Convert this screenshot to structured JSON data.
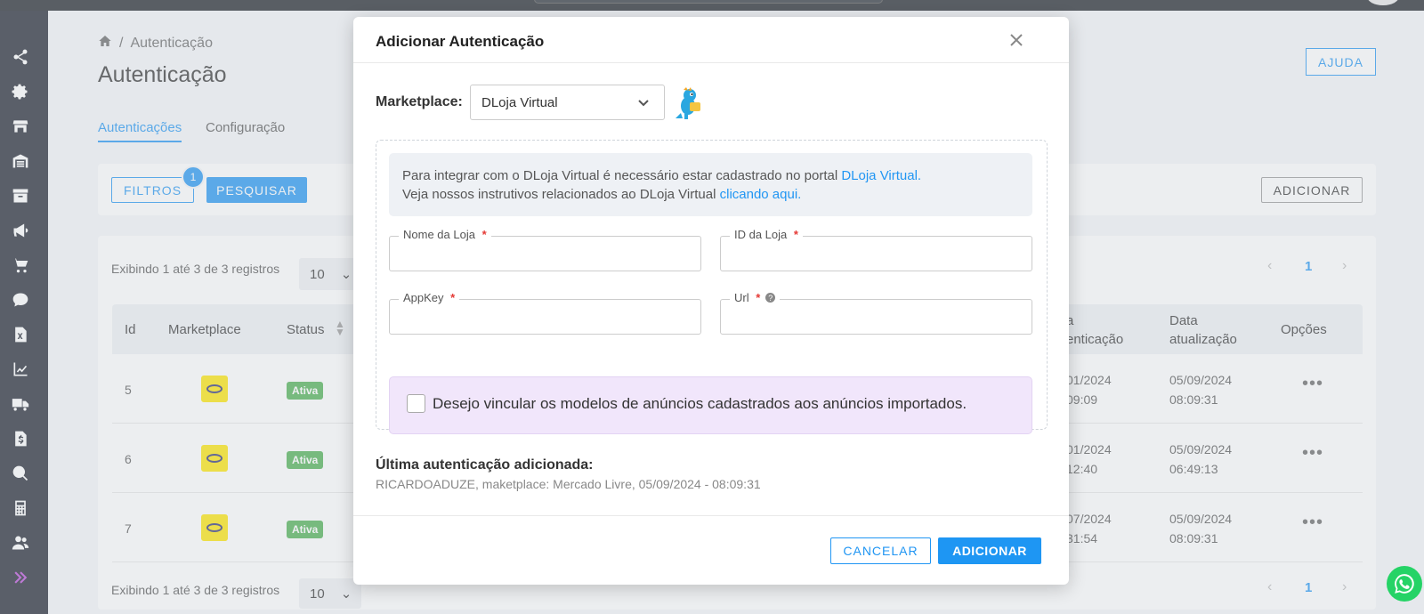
{
  "page": {
    "breadcrumb": "Autenticação",
    "breadcrumb_sep": "/",
    "title": "Autenticação",
    "tabs": [
      {
        "label": "Autenticações"
      },
      {
        "label": "Configuração"
      }
    ],
    "help_label": "AJUDA",
    "filters_label": "FILTROS",
    "filters_badge": "1",
    "search_label": "PESQUISAR",
    "add_label": "ADICIONAR",
    "showing_text": "Exibindo 1 até 3 de 3 registros",
    "per_page": "10",
    "current_page": "1",
    "columns": {
      "id": "Id",
      "marketplace": "Marketplace",
      "status": "Status",
      "auth_date_1": "a",
      "auth_date_2": "enticação",
      "updated_1": "Data",
      "updated_2": "atualização",
      "options": "Opções"
    },
    "rows": [
      {
        "id": "5",
        "status": "Ativa",
        "auth_1": "01/2024",
        "auth_2": "09:09",
        "upd_1": "05/09/2024",
        "upd_2": "08:09:31"
      },
      {
        "id": "6",
        "status": "Ativa",
        "auth_1": "01/2024",
        "auth_2": "12:40",
        "upd_1": "05/09/2024",
        "upd_2": "06:49:13"
      },
      {
        "id": "7",
        "status": "Ativa",
        "auth_1": "07/2024",
        "auth_2": "31:54",
        "upd_1": "05/09/2024",
        "upd_2": "08:09:31"
      }
    ],
    "ml_logo_text": "mercado livre"
  },
  "modal": {
    "title": "Adicionar Autenticação",
    "marketplace_label": "Marketplace:",
    "marketplace_value": "DLoja Virtual",
    "info_line1_prefix": "Para integrar com o DLoja Virtual é necessário estar cadastrado no portal ",
    "info_line1_link": "DLoja Virtual.",
    "info_line2_prefix": "Veja nossos instrutivos relacionados ao DLoja Virtual ",
    "info_line2_link": "clicando aqui.",
    "fields": {
      "store_name": {
        "label": "Nome da Loja",
        "value": ""
      },
      "store_id": {
        "label": "ID da Loja",
        "value": ""
      },
      "appkey": {
        "label": "AppKey",
        "value": ""
      },
      "url": {
        "label": "Url",
        "value": ""
      }
    },
    "required_mark": "*",
    "help_mark": "?",
    "checkbox_label": "Desejo vincular os modelos de anúncios cadastrados aos anúncios importados.",
    "checkbox_checked": false,
    "last_title": "Última autenticação adicionada:",
    "last_text": "RICARDOADUZE, maketplace: Mercado Livre, 05/09/2024 - 08:09:31",
    "cancel_label": "CANCELAR",
    "add_label": "ADICIONAR"
  },
  "colors": {
    "accent": "#2196f3",
    "success": "#4caf50",
    "sidebar": "#1f2430",
    "checkbox_bg": "#f1e6fb"
  },
  "icons": {
    "sidebar": [
      "share-icon",
      "gear-icon",
      "store-icon",
      "warehouse-icon",
      "archive-icon",
      "megaphone-icon",
      "cart-icon",
      "chat-icon",
      "excel-file-icon",
      "chart-line-icon",
      "truck-icon",
      "invoice-icon",
      "search-money-icon",
      "calculator-icon",
      "users-icon",
      "expand-icon"
    ]
  }
}
